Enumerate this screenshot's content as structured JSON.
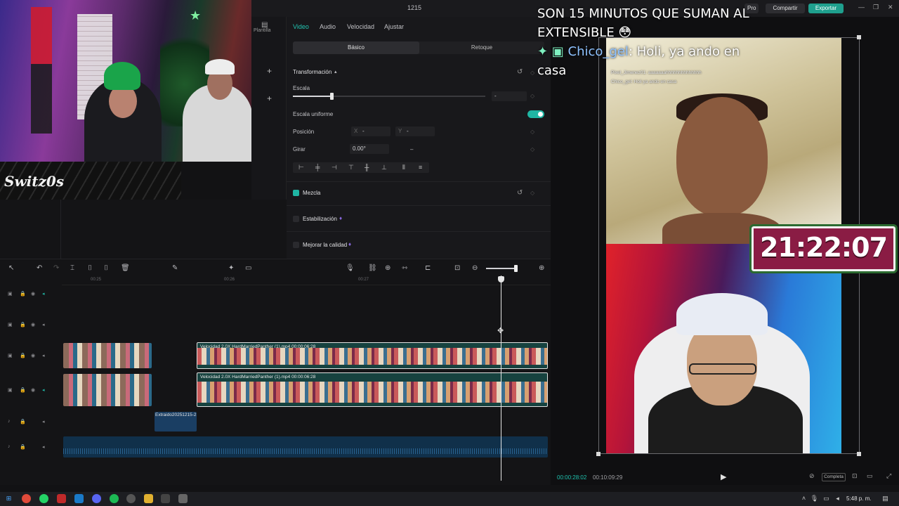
{
  "titlebar": {
    "project_name": "1215",
    "pro_label": "Pro",
    "share_label": "Compartir",
    "export_label": "Exportar"
  },
  "stream_overlay": {
    "logo_text": "Switz0s",
    "clock": "21:22:07",
    "chat_message_1": "SON 15 MINUTOS QUE SUMAN AL EXTENSIBLE 😳",
    "chat_user": "Chico_gel",
    "chat_message_2": ": Holi, ya ando en casa",
    "chat_small": [
      "Pixel_Jimenez01: aaaaaaahhhhhhhhhhhhhh",
      "Chico_gel: Holi ya ando en casa"
    ]
  },
  "side_panel": {
    "plantilla_label": "Plantilla"
  },
  "properties": {
    "tabs": [
      "Video",
      "Audio",
      "Velocidad",
      "Ajustar"
    ],
    "active_tab": "Video",
    "subtabs": [
      "Básico",
      "Retoque"
    ],
    "transform_label": "Transformación",
    "scale_label": "Escala",
    "scale_value": "-",
    "scale_level": 0.2,
    "uniform_scale_label": "Escala uniforme",
    "uniform_scale_on": true,
    "position_label": "Posición",
    "pos_x_label": "X",
    "pos_x_value": "-",
    "pos_y_label": "Y",
    "pos_y_value": "-",
    "rotate_label": "Girar",
    "rotate_value": "0.00°",
    "rotate_extra": "–",
    "blend_label": "Mezcla",
    "stabilize_label": "Estabilización",
    "enhance_label": "Mejorar la calidad"
  },
  "timeline": {
    "ruler_labels": [
      "00:25",
      "00:26",
      "00:27"
    ],
    "clip_label": "Velocidad 2.0X   HardMarriedPanther (1).mp4   00:00:06:28",
    "audio_clip_label": "Extraido20251215-2"
  },
  "player": {
    "current_time": "00:00:28:02",
    "total_time": "00:10:09:29",
    "full_label": "Completa"
  },
  "taskbar": {
    "time": "5:48 p. m."
  },
  "colors": {
    "accent": "#1fb5a3",
    "export_bg": "#1fa08e",
    "chat_user": "#8ec2ff"
  }
}
